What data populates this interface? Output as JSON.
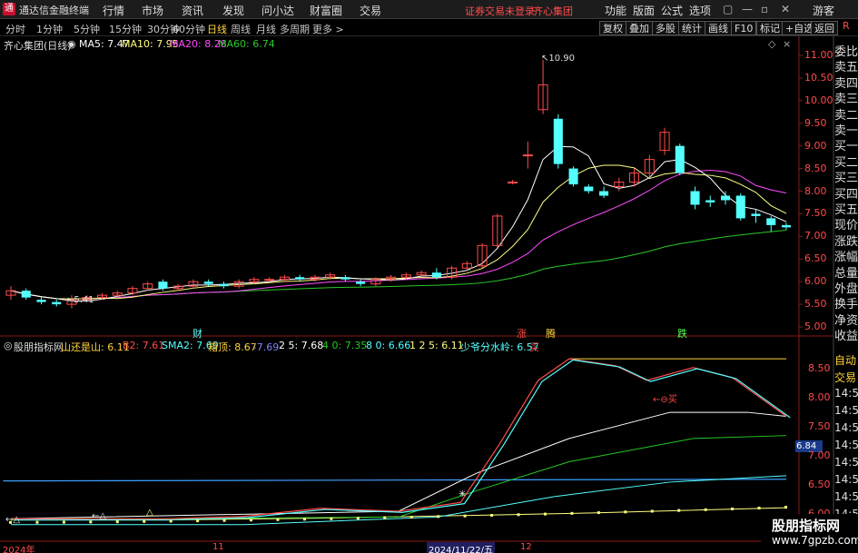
{
  "app": {
    "title": "通达信金融终端",
    "logo_char": "通"
  },
  "menu": [
    "行情",
    "市场",
    "资讯",
    "发现",
    "问小达",
    "财富圈",
    "交易"
  ],
  "notice": {
    "login": "证券交易未登录",
    "stock": "齐心集团"
  },
  "top_buttons": [
    "功能",
    "版面",
    "公式",
    "选项"
  ],
  "user": "游客",
  "window_controls": [
    "▢",
    "—",
    "▫",
    "✕"
  ],
  "periods": [
    "分时",
    "1分钟",
    "5分钟",
    "15分钟",
    "30分钟",
    "60分钟",
    "日线",
    "周线",
    "月线",
    "多周期",
    "更多 >"
  ],
  "active_period": "日线",
  "toolbar": [
    "复权",
    "叠加",
    "多股",
    "统计",
    "画线",
    "F10",
    "标记",
    "+自选",
    "返回"
  ],
  "r_badge": "R",
  "main_chart": {
    "stock": "齐心集团(日线)",
    "ma5": "MA5: 7.47",
    "ma10": "MA10: 7.95",
    "ma20": "MA20: 8.28",
    "ma60": "MA60: 6.74",
    "high_label": "10.90",
    "low_label": "5.41",
    "price_ticks": [
      "11.00",
      "10.50",
      "10.00",
      "9.50",
      "9.00",
      "8.50",
      "8.00",
      "7.50",
      "7.00",
      "6.50",
      "6.00",
      "5.50",
      "5.00"
    ],
    "markers": [
      "财",
      "涨",
      "腾",
      "跌"
    ]
  },
  "right_sidebar": [
    "委比",
    "卖五",
    "卖四",
    "卖三",
    "卖二",
    "卖一",
    "买一",
    "买二",
    "买三",
    "买四",
    "买五",
    "现价",
    "涨跌",
    "涨幅",
    "总量",
    "外盘",
    "换手",
    "净资",
    "收益"
  ],
  "indicator": {
    "name": "股朋指标网",
    "shan_label": "山还是山: 6.11",
    "b2_label": "B2: 7.61",
    "sma2_label": "SMA2: 7.69",
    "xiangding_label": "箱顶: 8.67",
    "v1_label": "7.69",
    "n25_label": "2 5: 7.68",
    "n40_label": "4 0: 7.35",
    "n80_label": "8 0: 6.66",
    "n125_label": "1 2 5: 6.11",
    "shaoye_label": "少爷分水岭: 6.57",
    "buy_label": "买",
    "buy_marker": "←⊖买",
    "value_box": "6.84",
    "ticks": [
      "8.50",
      "8.00",
      "7.50",
      "7.00",
      "6.50",
      "6.00"
    ],
    "right_items": [
      "自动",
      "交易",
      "14:56",
      "14:56",
      "14:56",
      "14:56",
      "14:56",
      "14:56",
      "14:56",
      "14:56"
    ]
  },
  "bottom_axis": {
    "year": "2024年",
    "m11": "11",
    "date": "2024/11/22/五",
    "m12": "12"
  },
  "watermark": {
    "title": "股朋指标网",
    "url": "www.7gpzb.com"
  },
  "colors": {
    "up": "#ff4b4b",
    "down": "#54ffff",
    "ma5": "#ffffff",
    "ma10": "#ffff80",
    "ma20": "#ff4bff",
    "ma60": "#28c828"
  },
  "chart_data": {
    "type": "candlestick",
    "ylim": [
      4.8,
      11.1
    ],
    "candles": [
      {
        "o": 5.7,
        "c": 5.8,
        "h": 5.9,
        "l": 5.6
      },
      {
        "o": 5.8,
        "c": 5.65,
        "h": 5.85,
        "l": 5.6
      },
      {
        "o": 5.6,
        "c": 5.55,
        "h": 5.65,
        "l": 5.5
      },
      {
        "o": 5.55,
        "c": 5.5,
        "h": 5.6,
        "l": 5.45
      },
      {
        "o": 5.5,
        "c": 5.6,
        "h": 5.7,
        "l": 5.41
      },
      {
        "o": 5.6,
        "c": 5.65,
        "h": 5.7,
        "l": 5.55
      },
      {
        "o": 5.65,
        "c": 5.7,
        "h": 5.75,
        "l": 5.6
      },
      {
        "o": 5.7,
        "c": 5.75,
        "h": 5.8,
        "l": 5.65
      },
      {
        "o": 5.75,
        "c": 5.85,
        "h": 5.9,
        "l": 5.7
      },
      {
        "o": 5.85,
        "c": 5.95,
        "h": 6.0,
        "l": 5.8
      },
      {
        "o": 6.0,
        "c": 5.85,
        "h": 6.05,
        "l": 5.8
      },
      {
        "o": 5.85,
        "c": 5.9,
        "h": 5.95,
        "l": 5.8
      },
      {
        "o": 5.9,
        "c": 6.0,
        "h": 6.05,
        "l": 5.85
      },
      {
        "o": 6.0,
        "c": 5.95,
        "h": 6.05,
        "l": 5.9
      },
      {
        "o": 5.95,
        "c": 5.9,
        "h": 6.0,
        "l": 5.85
      },
      {
        "o": 5.9,
        "c": 6.0,
        "h": 6.05,
        "l": 5.85
      },
      {
        "o": 6.0,
        "c": 6.05,
        "h": 6.1,
        "l": 5.95
      },
      {
        "o": 6.05,
        "c": 6.05,
        "h": 6.1,
        "l": 6.0
      },
      {
        "o": 6.05,
        "c": 6.1,
        "h": 6.15,
        "l": 6.0
      },
      {
        "o": 6.1,
        "c": 6.05,
        "h": 6.15,
        "l": 6.0
      },
      {
        "o": 6.05,
        "c": 6.1,
        "h": 6.15,
        "l": 6.0
      },
      {
        "o": 6.1,
        "c": 6.15,
        "h": 6.2,
        "l": 6.05
      },
      {
        "o": 6.1,
        "c": 6.05,
        "h": 6.15,
        "l": 6.0
      },
      {
        "o": 6.0,
        "c": 5.95,
        "h": 6.05,
        "l": 5.9
      },
      {
        "o": 5.95,
        "c": 6.05,
        "h": 6.1,
        "l": 5.9
      },
      {
        "o": 6.05,
        "c": 6.1,
        "h": 6.15,
        "l": 6.0
      },
      {
        "o": 6.1,
        "c": 6.15,
        "h": 6.2,
        "l": 6.05
      },
      {
        "o": 6.15,
        "c": 6.2,
        "h": 6.25,
        "l": 6.1
      },
      {
        "o": 6.2,
        "c": 6.1,
        "h": 6.3,
        "l": 6.05
      },
      {
        "o": 6.1,
        "c": 6.3,
        "h": 6.35,
        "l": 6.05
      },
      {
        "o": 6.3,
        "c": 6.4,
        "h": 6.45,
        "l": 6.25
      },
      {
        "o": 6.35,
        "c": 6.8,
        "h": 6.85,
        "l": 6.3
      },
      {
        "o": 6.8,
        "c": 7.45,
        "h": 7.5,
        "l": 6.75
      },
      {
        "o": 8.2,
        "c": 8.2,
        "h": 8.25,
        "l": 8.15
      },
      {
        "o": 8.8,
        "c": 8.8,
        "h": 9.1,
        "l": 8.5
      },
      {
        "o": 9.8,
        "c": 10.35,
        "h": 10.9,
        "l": 9.7
      },
      {
        "o": 9.6,
        "c": 8.6,
        "h": 9.7,
        "l": 8.5
      },
      {
        "o": 8.5,
        "c": 8.15,
        "h": 8.55,
        "l": 8.1
      },
      {
        "o": 8.1,
        "c": 8.0,
        "h": 8.15,
        "l": 7.95
      },
      {
        "o": 8.0,
        "c": 7.9,
        "h": 8.1,
        "l": 7.85
      },
      {
        "o": 8.1,
        "c": 8.2,
        "h": 8.3,
        "l": 8.0
      },
      {
        "o": 8.2,
        "c": 8.4,
        "h": 8.5,
        "l": 8.1
      },
      {
        "o": 8.4,
        "c": 8.7,
        "h": 8.8,
        "l": 8.3
      },
      {
        "o": 8.9,
        "c": 9.3,
        "h": 9.4,
        "l": 8.8
      },
      {
        "o": 9.0,
        "c": 8.4,
        "h": 9.05,
        "l": 8.35
      },
      {
        "o": 8.0,
        "c": 7.7,
        "h": 8.1,
        "l": 7.6
      },
      {
        "o": 7.8,
        "c": 7.75,
        "h": 7.9,
        "l": 7.65
      },
      {
        "o": 7.9,
        "c": 7.8,
        "h": 8.0,
        "l": 7.7
      },
      {
        "o": 7.9,
        "c": 7.4,
        "h": 7.95,
        "l": 7.35
      },
      {
        "o": 7.5,
        "c": 7.45,
        "h": 7.6,
        "l": 7.3
      },
      {
        "o": 7.4,
        "c": 7.25,
        "h": 7.45,
        "l": 7.1
      },
      {
        "o": 7.25,
        "c": 7.2,
        "h": 7.3,
        "l": 7.15
      }
    ]
  }
}
